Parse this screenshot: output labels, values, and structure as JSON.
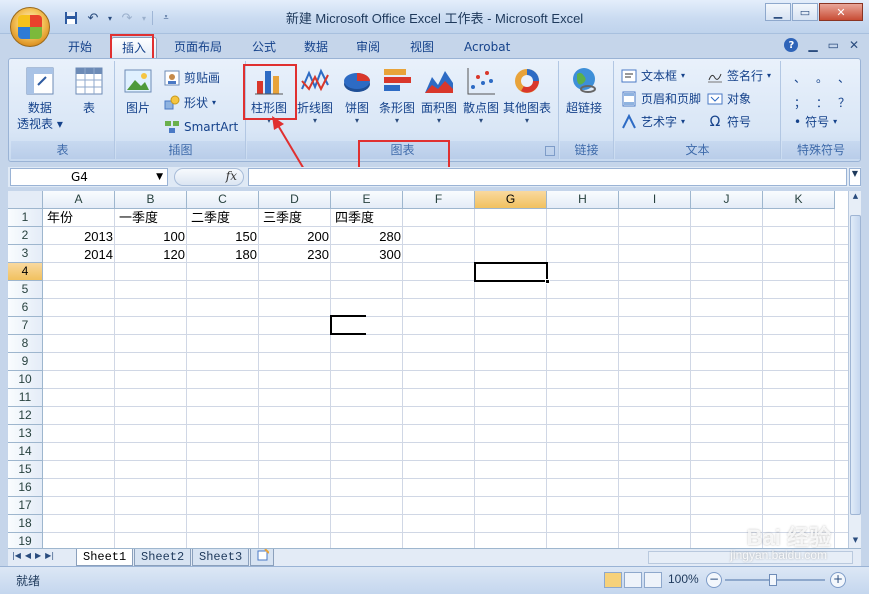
{
  "window": {
    "title": "新建 Microsoft Office Excel 工作表 - Microsoft Excel"
  },
  "tabs": [
    {
      "label": "开始"
    },
    {
      "label": "插入",
      "active": true
    },
    {
      "label": "页面布局"
    },
    {
      "label": "公式"
    },
    {
      "label": "数据"
    },
    {
      "label": "审阅"
    },
    {
      "label": "视图"
    },
    {
      "label": "Acrobat"
    }
  ],
  "ribbon": {
    "tables": {
      "label": "表",
      "pivot": "数据\n透视表",
      "pivot_line1": "数据",
      "pivot_line2": "透视表",
      "table": "表"
    },
    "illustrations": {
      "label": "插图",
      "picture": "图片",
      "clipart": "剪贴画",
      "shapes": "形状",
      "smartart": "SmartArt"
    },
    "charts": {
      "label": "图表",
      "column": "柱形图",
      "line": "折线图",
      "pie": "饼图",
      "bar": "条形图",
      "area": "面积图",
      "scatter": "散点图",
      "other": "其他图表"
    },
    "links": {
      "label": "链接",
      "hyperlink": "超链接"
    },
    "text": {
      "label": "文本",
      "textbox": "文本框",
      "header_footer": "页眉和页脚",
      "wordart": "艺术字",
      "signature": "签名行",
      "object": "对象",
      "symbol": "符号"
    },
    "special": {
      "label": "特殊符号",
      "symbol": "符号",
      "chars": [
        "、",
        "。",
        "、",
        "；",
        "：",
        "？"
      ]
    }
  },
  "formula_bar": {
    "name_box": "G4",
    "fx": "fx",
    "formula": ""
  },
  "grid": {
    "columns": [
      "A",
      "B",
      "C",
      "D",
      "E",
      "F",
      "G",
      "H",
      "I",
      "J",
      "K"
    ],
    "selected_column": "G",
    "rows": [
      "1",
      "2",
      "3",
      "4",
      "5",
      "6",
      "7",
      "8",
      "9",
      "10",
      "11",
      "12",
      "13",
      "14",
      "15",
      "16",
      "17",
      "18",
      "19"
    ],
    "selected_row": "4",
    "cells": {
      "header": [
        "年份",
        "一季度",
        "二季度",
        "三季度",
        "四季度"
      ],
      "row2": [
        "2013",
        "100",
        "150",
        "200",
        "280"
      ],
      "row3": [
        "2014",
        "120",
        "180",
        "230",
        "300"
      ]
    }
  },
  "sheets": [
    "Sheet1",
    "Sheet2",
    "Sheet3"
  ],
  "active_sheet": "Sheet1",
  "status": {
    "ready": "就绪",
    "zoom": "100%"
  },
  "watermark": {
    "brand": "Bai 经验",
    "url": "jingyan.baidu.com"
  },
  "colors": {
    "annotation": "#e03030",
    "selected_header": "#f1c15f"
  }
}
